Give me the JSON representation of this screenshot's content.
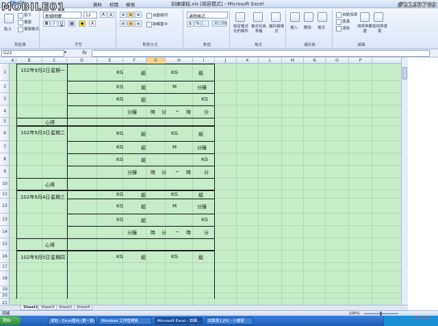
{
  "app": {
    "title": "訓練課程.xls [相容模式] - Microsoft Excel",
    "tabs": [
      "資料",
      "校閱",
      "檢視"
    ]
  },
  "ribbon": {
    "clipboard": {
      "paste": "貼上",
      "cut": "剪下",
      "copy": "複製",
      "format_painter": "複製格式",
      "label": "剪貼簿"
    },
    "font": {
      "name": "新細明體",
      "size": "12",
      "label": "字型"
    },
    "alignment": {
      "wrap": "自動換列",
      "merge": "跨欄置中",
      "label": "對齊方式"
    },
    "number": {
      "format": "通用格式",
      "label": "數值"
    },
    "styles": {
      "conditional": "設定格式化的條件",
      "table": "格式化為表格",
      "cell": "儲存格樣式",
      "label": "樣式"
    },
    "cells": {
      "insert": "插入",
      "delete": "刪除",
      "format": "格式",
      "label": "儲存格"
    },
    "editing": {
      "autosum": "自動加總",
      "fill": "填滿",
      "clear": "清除",
      "sort": "排序與篩選",
      "find": "尋找與選取",
      "label": "編輯"
    }
  },
  "formula_bar": {
    "name_box": "G22",
    "fx": "fx",
    "value": ""
  },
  "columns": [
    "A",
    "B",
    "C",
    "D",
    "E",
    "F",
    "G",
    "H",
    "I",
    "J",
    "K",
    "L",
    "M",
    "N",
    "O",
    "P"
  ],
  "selected_column": "G",
  "rows": [
    "1",
    "2",
    "3",
    "4",
    "5",
    "6",
    "7",
    "8",
    "9",
    "10",
    "11",
    "12",
    "13",
    "14",
    "15",
    "16",
    "17",
    "18",
    "19",
    "20",
    "21"
  ],
  "blocks": [
    {
      "date": "102年9月2日",
      "day": "星期一",
      "note": "心得"
    },
    {
      "date": "102年9月3日",
      "day": "星期二",
      "note": "心得"
    },
    {
      "date": "102年9月4日",
      "day": "星期三",
      "note": "心得"
    },
    {
      "date": "102年9月5日",
      "day": "星期四",
      "note": ""
    }
  ],
  "units": {
    "kg": "KG",
    "set": "組",
    "m": "M",
    "minute": "分鐘",
    "time": "時",
    "fen": "分",
    "tilde": "~"
  },
  "sheet_tabs": [
    "Sheet1",
    "Sheet3",
    "Sheet2",
    "Sheet4"
  ],
  "status": {
    "text": "就緒",
    "zoom": "100%"
  },
  "taskbar": {
    "start": "開始",
    "items": [
      "求助 - Excel應用 (第一頁)",
      "Windows 工作管理員",
      "Microsoft Excel - 訓練...",
      "試算表1.JPG - 小畫家"
    ],
    "clock": "下午 09:07"
  },
  "watermark": {
    "logo": "MOBILE01",
    "id": "#2193789"
  }
}
